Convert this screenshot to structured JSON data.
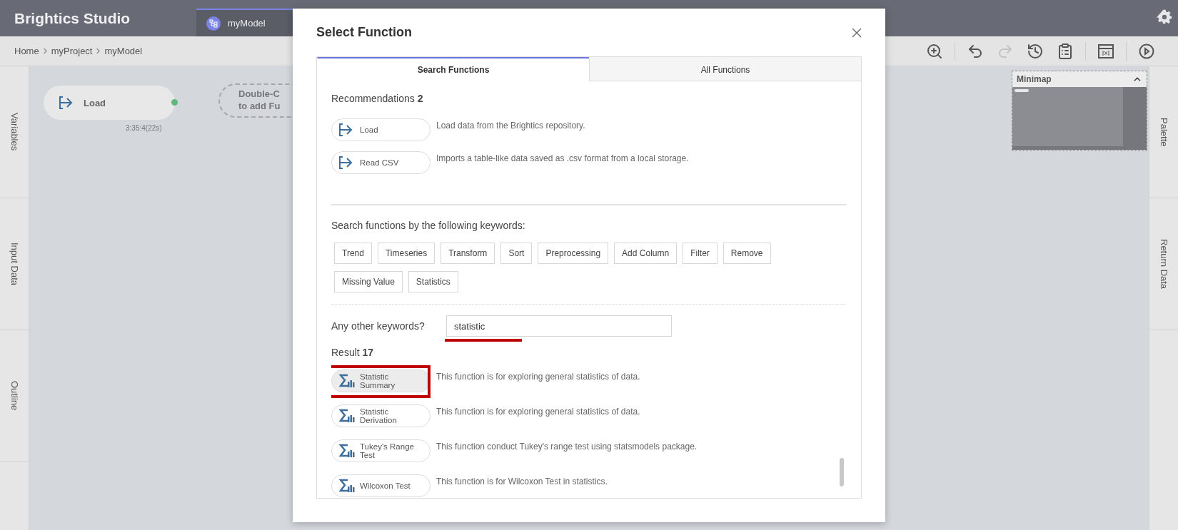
{
  "app": {
    "title": "Brightics Studio"
  },
  "tabs": [
    {
      "label": "myModel",
      "selected": true
    }
  ],
  "breadcrumb": [
    "Home",
    "myProject",
    "myModel"
  ],
  "toolbar": [
    {
      "disabled": false
    },
    {
      "disabled": false
    },
    {
      "disabled": true
    },
    {
      "disabled": false
    },
    {
      "disabled": false
    },
    {
      "disabled": false
    },
    {
      "disabled": false
    }
  ],
  "left_panel": [
    "Variables",
    "Input Data",
    "Outline"
  ],
  "right_panel": [
    "Palette",
    "Return Data"
  ],
  "canvas": {
    "nodes": [
      {
        "kind": "function",
        "label": "Load",
        "time": "3:35:4(22s)"
      },
      {
        "kind": "placeholder",
        "lines": [
          "Double-C",
          "to add Fu"
        ]
      }
    ]
  },
  "minimap": {
    "title": "Minimap",
    "expanded": true
  },
  "dialog": {
    "title": "Select Function",
    "tabs": [
      {
        "label": "Search Functions",
        "selected": true
      },
      {
        "label": "All Functions",
        "selected": false
      }
    ],
    "recommendations": {
      "heading": "Recommendations",
      "count": "2",
      "items": [
        {
          "name": "Load",
          "description": "Load data from the Brightics repository."
        },
        {
          "name": "Read CSV",
          "description": "Imports a table-like data saved as .csv format from a local storage."
        }
      ]
    },
    "keywords": {
      "heading": "Search functions by the following keywords:",
      "items": [
        "Trend",
        "Timeseries",
        "Transform",
        "Sort",
        "Preprocessing",
        "Add Column",
        "Filter",
        "Remove",
        "Missing Value",
        "Statistics"
      ]
    },
    "search": {
      "label": "Any other keywords?",
      "value": "statistic",
      "underlined": true
    },
    "results": {
      "heading": "Result",
      "count": "17",
      "items": [
        {
          "name": "Statistic Summary",
          "description": "This function is for exploring general statistics of data.",
          "highlighted": true
        },
        {
          "name": "Statistic Derivation",
          "description": "This function is for exploring general statistics of data.",
          "highlighted": false
        },
        {
          "name": "Tukey's Range Test",
          "description": "This function conduct Tukey's range test using statsmodels package.",
          "highlighted": false
        },
        {
          "name": "Wilcoxon Test",
          "description": "This function is for Wilcoxon Test in statistics.",
          "highlighted": false
        }
      ]
    }
  }
}
